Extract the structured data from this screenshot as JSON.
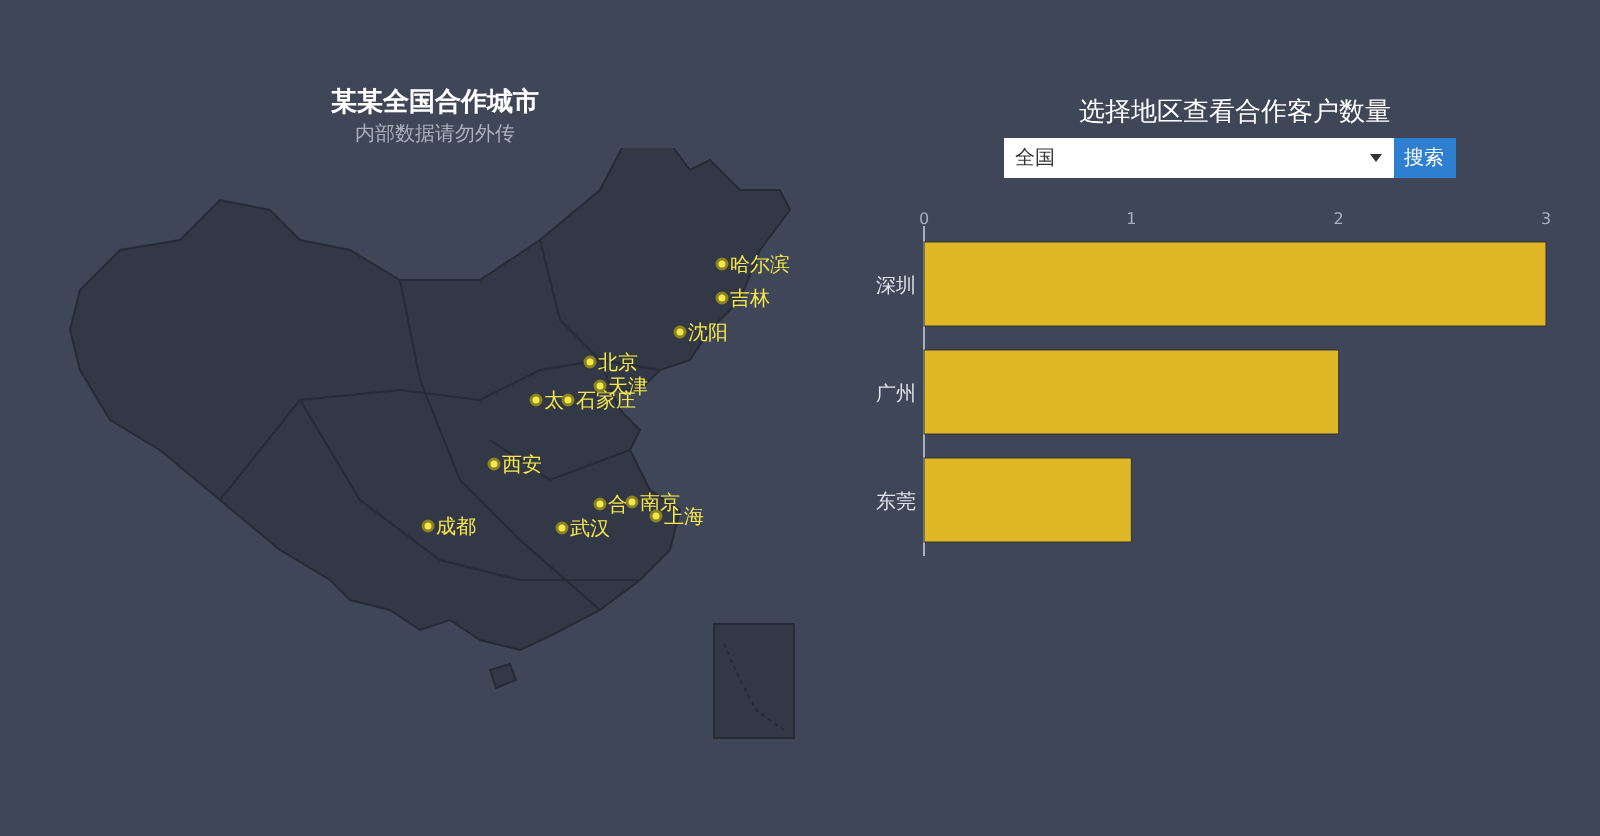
{
  "map_panel": {
    "title": "某某全国合作城市",
    "subtitle": "内部数据请勿外传",
    "cities": [
      {
        "name": "哈尔滨"
      },
      {
        "name": "吉林"
      },
      {
        "name": "沈阳"
      },
      {
        "name": "北京"
      },
      {
        "name": "天津"
      },
      {
        "name": "太"
      },
      {
        "name": "石家庄"
      },
      {
        "name": "西安"
      },
      {
        "name": "成都"
      },
      {
        "name": "武汉"
      },
      {
        "name": "合"
      },
      {
        "name": "南京"
      },
      {
        "name": "上海"
      }
    ]
  },
  "chart_panel": {
    "title": "选择地区查看合作客户数量",
    "region_select": {
      "value": "全国"
    },
    "search_button": "搜索",
    "chart_data": {
      "type": "bar",
      "orientation": "horizontal",
      "categories": [
        "深圳",
        "广州",
        "东莞"
      ],
      "values": [
        3,
        2,
        1
      ],
      "xlim": [
        0,
        3
      ],
      "xticks": [
        0,
        1,
        2,
        3
      ]
    }
  }
}
